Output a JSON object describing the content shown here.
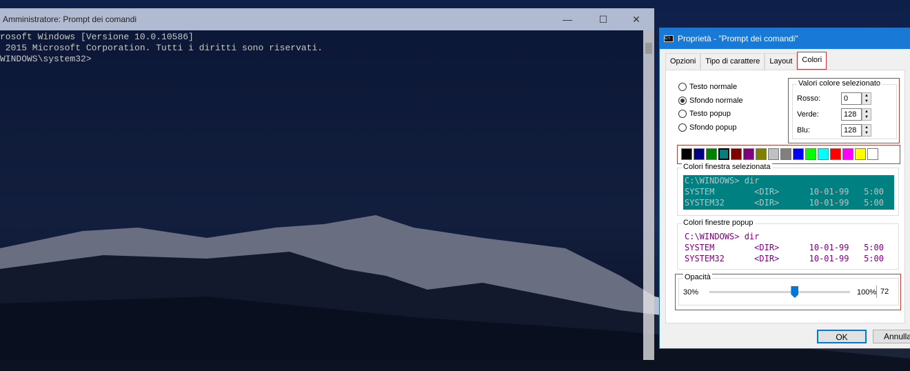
{
  "cmd": {
    "title": "Amministratore: Prompt dei comandi",
    "lines": [
      "rosoft Windows [Versione 10.0.10586]",
      " 2015 Microsoft Corporation. Tutti i diritti sono riservati.",
      "",
      "WINDOWS\\system32>"
    ]
  },
  "dialog": {
    "title": "Proprietà - \"Prompt dei comandi\"",
    "tabs": [
      "Opzioni",
      "Tipo di carattere",
      "Layout",
      "Colori"
    ],
    "radios": [
      "Testo normale",
      "Sfondo normale",
      "Testo popup",
      "Sfondo popup"
    ],
    "selected_radio": 1,
    "values_group": "Valori colore selezionato",
    "red_label": "Rosso:",
    "red": "0",
    "green_label": "Verde:",
    "green": "128",
    "blue_label": "Blu:",
    "blue": "128",
    "palette": [
      "#000000",
      "#000080",
      "#008000",
      "#008080",
      "#800000",
      "#800080",
      "#808000",
      "#c0c0c0",
      "#808080",
      "#0000ff",
      "#00ff00",
      "#00ffff",
      "#ff0000",
      "#ff00ff",
      "#ffff00",
      "#ffffff"
    ],
    "selected_palette": 3,
    "screen_group": "Colori finestra selezionata",
    "popup_group": "Colori finestre popup",
    "preview": [
      "C:\\WINDOWS> dir",
      "SYSTEM        <DIR>      10-01-99   5:00",
      "SYSTEM32      <DIR>      10-01-99   5:00"
    ],
    "screen_bg": "#008080",
    "screen_fg": "#c0c0c0",
    "popup_fg": "#800080",
    "opacity_group": "Opacità",
    "opacity_min": "30%",
    "opacity_max": "100%",
    "opacity": "72",
    "ok": "OK",
    "cancel": "Annulla"
  }
}
